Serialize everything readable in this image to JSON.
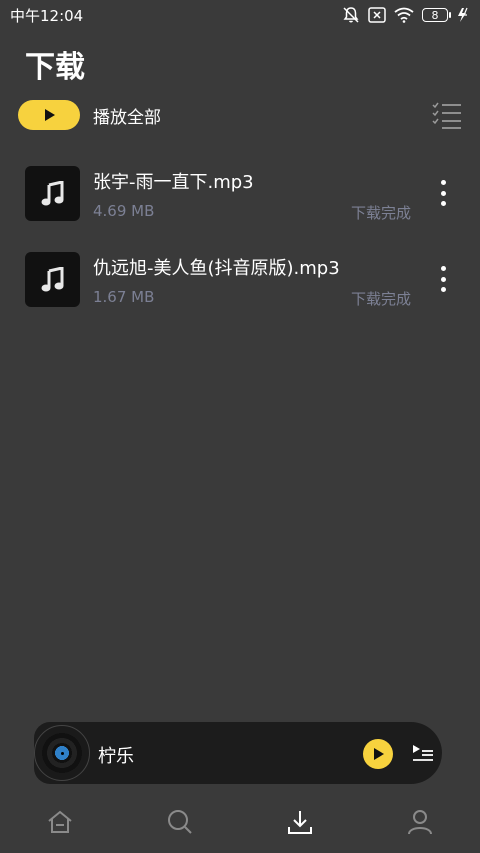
{
  "status_bar": {
    "time": "中午12:04",
    "battery": "8",
    "icons": [
      "mute-icon",
      "sim-off-icon",
      "wifi-icon",
      "battery-icon",
      "charging-icon"
    ]
  },
  "header": {
    "title": "下载"
  },
  "toolbar": {
    "play_all_label": "播放全部",
    "accent": "#f7d23e"
  },
  "songs": [
    {
      "title": "张宇-雨一直下.mp3",
      "size": "4.69 MB",
      "status": "下载完成"
    },
    {
      "title": "仇远旭-美人鱼(抖音原版).mp3",
      "size": "1.67 MB",
      "status": "下载完成"
    }
  ],
  "player": {
    "title": "柠乐"
  },
  "tabs": [
    {
      "name": "home",
      "icon": "home-icon"
    },
    {
      "name": "search",
      "icon": "search-icon"
    },
    {
      "name": "download",
      "icon": "download-icon",
      "active": true
    },
    {
      "name": "profile",
      "icon": "profile-icon"
    }
  ]
}
